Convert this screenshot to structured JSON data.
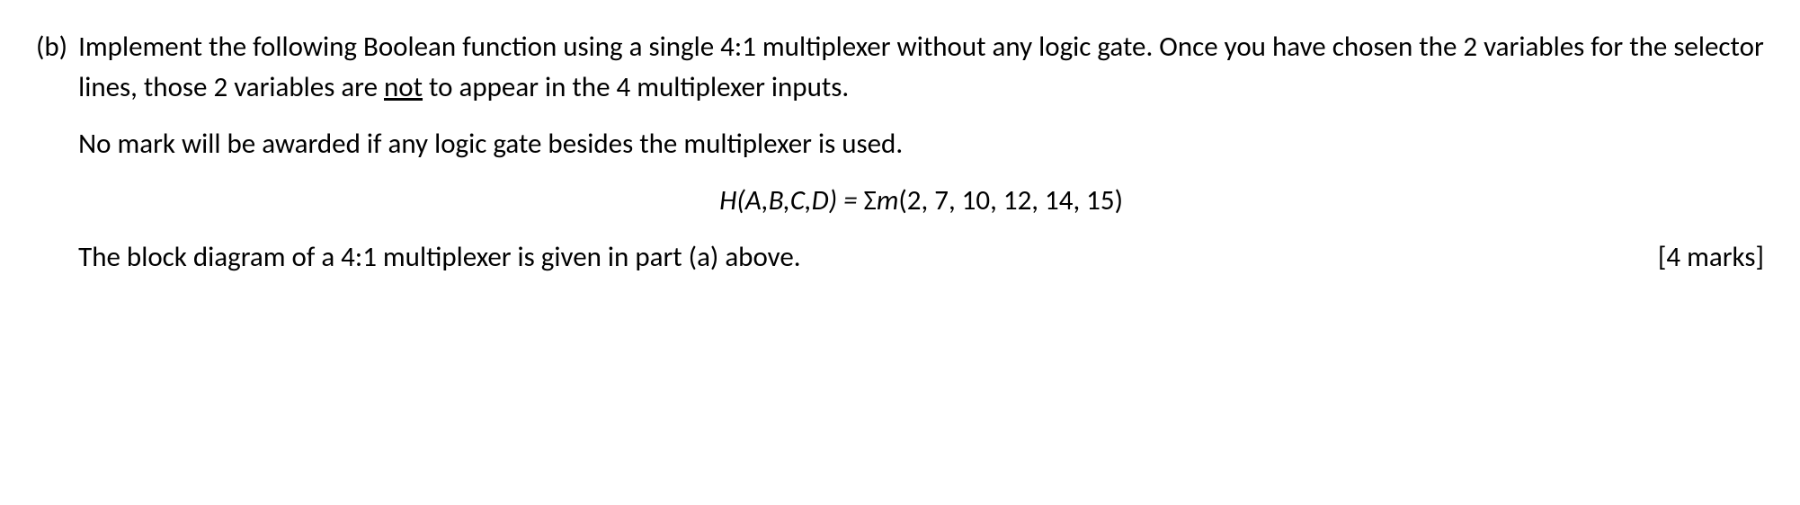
{
  "question": {
    "label": "(b)",
    "paragraph1_part1": "Implement the following Boolean function using a single 4:1 multiplexer without any logic gate. Once you have chosen the 2 variables for the selector lines, those 2 variables are ",
    "paragraph1_underlined": "not",
    "paragraph1_part2": " to appear in the 4 multiplexer inputs.",
    "no_mark_line": "No mark will be awarded if any logic gate besides the multiplexer is used.",
    "formula": {
      "func": "H",
      "open_paren": "(",
      "vars": "A,B,C,D",
      "close_paren": ")",
      "equals": " = ",
      "sigma": "Σ",
      "m": "m",
      "nums": "(2, 7, 10, 12, 14, 15)"
    },
    "last_line": "The block diagram of a 4:1 multiplexer is given in part (a) above.",
    "marks": "[4 marks]"
  }
}
